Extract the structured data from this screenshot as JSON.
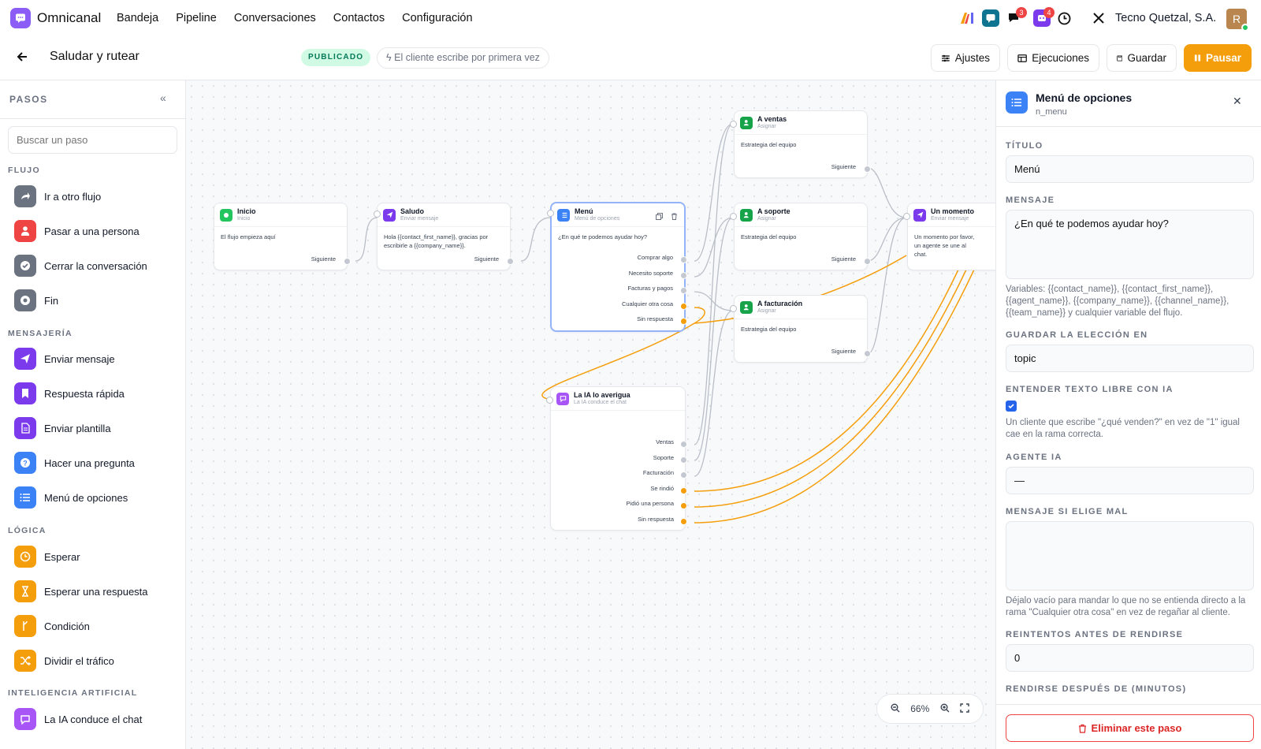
{
  "app": {
    "name": "Omnicanal",
    "nav": [
      "Bandeja",
      "Pipeline",
      "Conversaciones",
      "Contactos",
      "Configuración"
    ],
    "company": "Tecno Quetzal, S.A.",
    "avatar_initial": "R",
    "badges": {
      "chat": "3",
      "bot": "4"
    }
  },
  "flow": {
    "title": "Saludar y rutear",
    "status": "PUBLICADO",
    "trigger": "El cliente escribe por primera vez",
    "buttons": {
      "settings": "Ajustes",
      "runs": "Ejecuciones",
      "save": "Guardar",
      "pause": "Pausar"
    }
  },
  "sidebar": {
    "title": "PASOS",
    "search_placeholder": "Buscar un paso",
    "categories": [
      {
        "name": "FLUJO",
        "items": [
          {
            "label": "Ir a otro flujo",
            "icon": "share-icon",
            "color": "#6b7280"
          },
          {
            "label": "Pasar a una persona",
            "icon": "person-icon",
            "color": "#ef4444"
          },
          {
            "label": "Cerrar la conversación",
            "icon": "check-circle-icon",
            "color": "#6b7280"
          },
          {
            "label": "Fin",
            "icon": "stop-icon",
            "color": "#6b7280"
          }
        ]
      },
      {
        "name": "MENSAJERÍA",
        "items": [
          {
            "label": "Enviar mensaje",
            "icon": "send-icon",
            "color": "#7c3aed"
          },
          {
            "label": "Respuesta rápida",
            "icon": "bookmark-icon",
            "color": "#7c3aed"
          },
          {
            "label": "Enviar plantilla",
            "icon": "document-icon",
            "color": "#7c3aed"
          },
          {
            "label": "Hacer una pregunta",
            "icon": "question-icon",
            "color": "#3b82f6"
          },
          {
            "label": "Menú de opciones",
            "icon": "list-icon",
            "color": "#3b82f6"
          }
        ]
      },
      {
        "name": "LÓGICA",
        "items": [
          {
            "label": "Esperar",
            "icon": "clock-icon",
            "color": "#f59e0b"
          },
          {
            "label": "Esperar una respuesta",
            "icon": "hourglass-icon",
            "color": "#f59e0b"
          },
          {
            "label": "Condición",
            "icon": "branch-icon",
            "color": "#f59e0b"
          },
          {
            "label": "Dividir el tráfico",
            "icon": "shuffle-icon",
            "color": "#f59e0b"
          }
        ]
      },
      {
        "name": "INTELIGENCIA ARTIFICIAL",
        "items": [
          {
            "label": "La IA conduce el chat",
            "icon": "chat-bubble-icon",
            "color": "#a855f7"
          }
        ]
      }
    ]
  },
  "nodes": {
    "inicio": {
      "title": "Inicio",
      "subtitle": "Inicio",
      "body": "El flujo empieza aquí",
      "outputs": [
        "Siguiente"
      ]
    },
    "saludo": {
      "title": "Saludo",
      "subtitle": "Enviar mensaje",
      "body": "Hola {{contact_first_name}}, gracias por escribirle a {{company_name}}.",
      "outputs": [
        "Siguiente"
      ]
    },
    "menu": {
      "title": "Menú",
      "subtitle": "Menú de opciones",
      "body": "¿En qué te podemos ayudar hoy?",
      "outputs": [
        "Comprar algo",
        "Necesito soporte",
        "Facturas y pagos",
        "Cualquier otra cosa",
        "Sin respuesta"
      ]
    },
    "ventas": {
      "title": "A ventas",
      "subtitle": "Asignar",
      "body": "Estrategia del equipo",
      "outputs": [
        "Siguiente"
      ]
    },
    "soporte": {
      "title": "A soporte",
      "subtitle": "Asignar",
      "body": "Estrategia del equipo",
      "outputs": [
        "Siguiente"
      ]
    },
    "facturacion": {
      "title": "A facturación",
      "subtitle": "Asignar",
      "body": "Estrategia del equipo",
      "outputs": [
        "Siguiente"
      ]
    },
    "momento": {
      "title": "Un momento",
      "subtitle": "Enviar mensaje",
      "body": "Un momento por favor, un agente se une al chat."
    },
    "ia": {
      "title": "La IA lo averigua",
      "subtitle": "La IA conduce el chat",
      "outputs": [
        "Ventas",
        "Soporte",
        "Facturación",
        "Se rindió",
        "Pidió una persona",
        "Sin respuesta"
      ]
    }
  },
  "zoom": "66%",
  "panel": {
    "title": "Menú de opciones",
    "id": "n_menu",
    "fields": {
      "titulo_label": "TÍTULO",
      "titulo_value": "Menú",
      "mensaje_label": "MENSAJE",
      "mensaje_value": "¿En qué te podemos ayudar hoy?",
      "mensaje_help": "Variables: {{contact_name}}, {{contact_first_name}}, {{agent_name}}, {{company_name}}, {{channel_name}}, {{team_name}} y cualquier variable del flujo.",
      "guardar_label": "GUARDAR LA ELECCIÓN EN",
      "guardar_value": "topic",
      "ia_label": "ENTENDER TEXTO LIBRE CON IA",
      "ia_checked": true,
      "ia_help": "Un cliente que escribe \"¿qué venden?\" en vez de \"1\" igual cae en la rama correcta.",
      "agente_label": "AGENTE IA",
      "agente_value": "—",
      "elige_mal_label": "MENSAJE SI ELIGE MAL",
      "elige_mal_value": "",
      "elige_mal_help": "Déjalo vacío para mandar lo que no se entienda directo a la rama \"Cualquier otra cosa\" en vez de regañar al cliente.",
      "reintentos_label": "REINTENTOS ANTES DE RENDIRSE",
      "reintentos_value": "0",
      "rendirse_label": "RENDIRSE DESPUÉS DE (MINUTOS)"
    },
    "delete_label": "Eliminar este paso"
  }
}
